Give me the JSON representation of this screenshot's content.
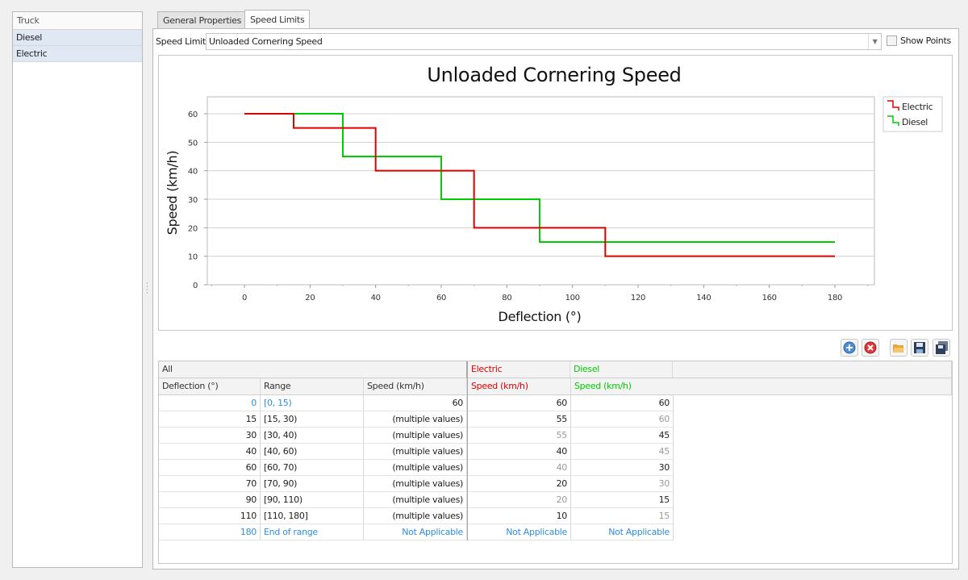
{
  "left_panel": {
    "header": "Truck",
    "items": [
      "Diesel",
      "Electric"
    ]
  },
  "tabs": [
    {
      "label": "General Properties"
    },
    {
      "label": "Speed Limits"
    }
  ],
  "speed_limit": {
    "label": "Speed Limit",
    "value": "Unloaded Cornering Speed"
  },
  "show_points": {
    "label": "Show Points",
    "checked": false
  },
  "colors": {
    "electric": "#e00000",
    "diesel": "#00cc00",
    "link": "#2b8ee8"
  },
  "chart_data": {
    "type": "line",
    "title": "Unloaded Cornering Speed",
    "xlabel": "Deflection (°)",
    "ylabel": "Speed (km/h)",
    "xlim": [
      -12,
      192
    ],
    "ylim": [
      0,
      66
    ],
    "xticks": [
      0,
      20,
      40,
      60,
      80,
      100,
      120,
      140,
      160,
      180
    ],
    "yticks": [
      0,
      10,
      20,
      30,
      40,
      50,
      60
    ],
    "legend_position": "right",
    "series": [
      {
        "name": "Electric",
        "color": "#e00000",
        "x": [
          0,
          15,
          40,
          70,
          110,
          180
        ],
        "y": [
          60,
          55,
          40,
          20,
          10,
          10
        ]
      },
      {
        "name": "Diesel",
        "color": "#00cc00",
        "x": [
          0,
          30,
          60,
          90,
          180
        ],
        "y": [
          60,
          45,
          30,
          15,
          15
        ]
      }
    ]
  },
  "toolbar": [
    "add-icon",
    "delete-icon",
    "open-folder-icon",
    "save-icon",
    "save-all-icon"
  ],
  "table": {
    "group_headers": [
      "All",
      "Electric",
      "Diesel"
    ],
    "columns": [
      "Deflection (°)",
      "Range",
      "Speed (km/h)",
      "Speed (km/h)",
      "Speed (km/h)"
    ],
    "rows": [
      {
        "d": "0",
        "range": "[0, 15)",
        "speed": "60",
        "e": "60",
        "dz": "60",
        "style": [
          "blue",
          "blue",
          "",
          "",
          ""
        ]
      },
      {
        "d": "15",
        "range": "[15, 30)",
        "speed": "(multiple values)",
        "e": "55",
        "dz": "60",
        "style": [
          "",
          "",
          "",
          "",
          "grey"
        ]
      },
      {
        "d": "30",
        "range": "[30, 40)",
        "speed": "(multiple values)",
        "e": "55",
        "dz": "45",
        "style": [
          "",
          "",
          "",
          "grey",
          ""
        ]
      },
      {
        "d": "40",
        "range": "[40, 60)",
        "speed": "(multiple values)",
        "e": "40",
        "dz": "45",
        "style": [
          "",
          "",
          "",
          "",
          "grey"
        ]
      },
      {
        "d": "60",
        "range": "[60, 70)",
        "speed": "(multiple values)",
        "e": "40",
        "dz": "30",
        "style": [
          "",
          "",
          "",
          "grey",
          ""
        ]
      },
      {
        "d": "70",
        "range": "[70, 90)",
        "speed": "(multiple values)",
        "e": "20",
        "dz": "30",
        "style": [
          "",
          "",
          "",
          "",
          "grey"
        ]
      },
      {
        "d": "90",
        "range": "[90, 110)",
        "speed": "(multiple values)",
        "e": "20",
        "dz": "15",
        "style": [
          "",
          "",
          "",
          "grey",
          ""
        ]
      },
      {
        "d": "110",
        "range": "[110, 180]",
        "speed": "(multiple values)",
        "e": "10",
        "dz": "15",
        "style": [
          "",
          "",
          "",
          "",
          "grey"
        ]
      },
      {
        "d": "180",
        "range": "End of range",
        "speed": "Not Applicable",
        "e": "Not Applicable",
        "dz": "Not Applicable",
        "style": [
          "blue",
          "blue",
          "blue",
          "blue",
          "blue"
        ]
      }
    ]
  }
}
